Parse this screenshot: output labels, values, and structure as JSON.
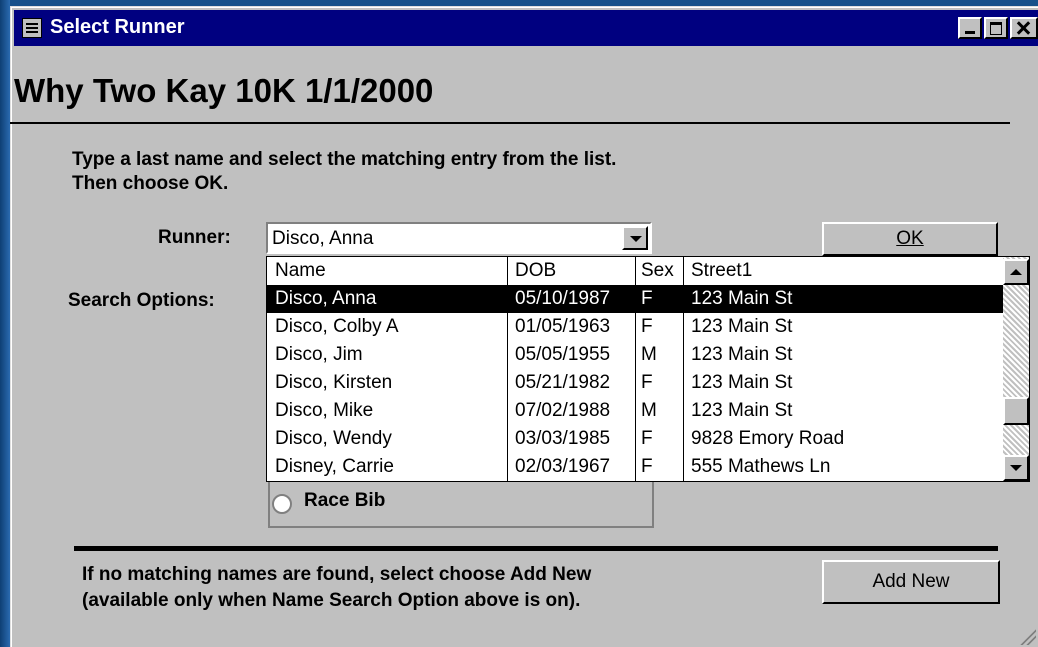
{
  "window": {
    "title": "Select Runner"
  },
  "heading": "Why Two Kay 10K 1/1/2000",
  "instructions": {
    "line1": "Type a last name and select the matching entry from the list.",
    "line2": "Then choose OK."
  },
  "runner": {
    "label": "Runner:",
    "value": "Disco, Anna"
  },
  "search_options": {
    "label": "Search Options:",
    "race_bib_label": "Race Bib"
  },
  "ok_button": {
    "label": "OK"
  },
  "dropdown": {
    "columns": [
      "Name",
      "DOB",
      "Sex",
      "Street1"
    ],
    "rows": [
      {
        "name": "Disco, Anna",
        "dob": "05/10/1987",
        "sex": "F",
        "street": "123 Main St"
      },
      {
        "name": "Disco, Colby A",
        "dob": "01/05/1963",
        "sex": "F",
        "street": "123 Main St"
      },
      {
        "name": "Disco, Jim",
        "dob": "05/05/1955",
        "sex": "M",
        "street": "123 Main St"
      },
      {
        "name": "Disco, Kirsten",
        "dob": "05/21/1982",
        "sex": "F",
        "street": "123 Main St"
      },
      {
        "name": "Disco, Mike",
        "dob": "07/02/1988",
        "sex": "M",
        "street": "123 Main St"
      },
      {
        "name": "Disco, Wendy",
        "dob": "03/03/1985",
        "sex": "F",
        "street": "9828 Emory Road"
      },
      {
        "name": "Disney, Carrie",
        "dob": "02/03/1967",
        "sex": "F",
        "street": "555 Mathews Ln"
      }
    ],
    "selected_index": 0
  },
  "footer": {
    "line1": "If no matching names are found, select choose Add New",
    "line2": "(available only when Name Search Option above is on)."
  },
  "add_new_button": {
    "label": "Add New"
  },
  "colors": {
    "titlebar": "#000080",
    "window": "#c0c0c0",
    "desktop": "#16508a",
    "selection": "#000000"
  }
}
